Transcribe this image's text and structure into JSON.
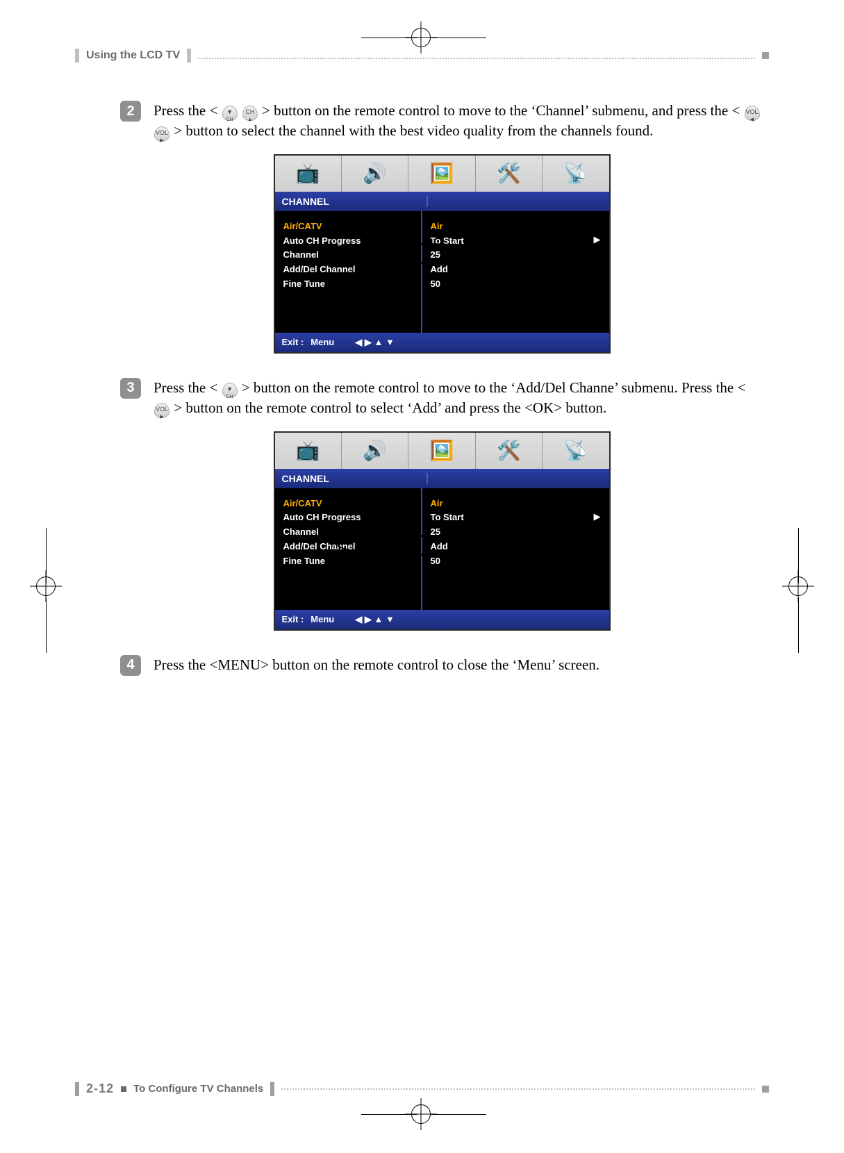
{
  "header": {
    "title": "Using the LCD TV"
  },
  "steps": [
    {
      "num": "2",
      "text_segments": [
        "Press the < ",
        "[CH-DN]",
        " ",
        "[CH-UP]",
        " > button on the remote control to move to the ‘Channel’ submenu, and press the < ",
        "[VOL-L]",
        " ",
        "[VOL-R]",
        " > button to select the channel with the best video quality from the channels found."
      ]
    },
    {
      "num": "3",
      "text_segments": [
        "Press the < ",
        "[CH-DN]",
        " > button on the remote control to move to the ‘Add/Del Channe’ submenu. Press the < ",
        "[VOL-R]",
        " > button on the remote control to select ‘Add’ and press the <OK> button."
      ]
    },
    {
      "num": "4",
      "text_segments": [
        "Press the <MENU> button on the remote control to close the ‘Menu’ screen."
      ]
    }
  ],
  "osd": {
    "title": "CHANNEL",
    "footer_exit": "Exit :",
    "footer_menu": "Menu",
    "footer_arrows": "◀ ▶ ▲ ▼",
    "rows": [
      {
        "label": "Air/CATV",
        "value": "Air",
        "highlight": true
      },
      {
        "label": "Auto CH Progress",
        "value": "To Start",
        "arrow": true
      },
      {
        "label": "Channel",
        "value": "25"
      },
      {
        "label": "Add/Del Channel",
        "value": "Add"
      },
      {
        "label": "Fine Tune",
        "value": "50"
      }
    ],
    "ellipse_targets": {
      "screen1_row_index": 2,
      "screen2_row_index": 3
    }
  },
  "footer": {
    "page_num": "2-12",
    "section": "To Configure TV Channels"
  },
  "remote_buttons": {
    "CH-DN": {
      "top": "▼",
      "bottom": "CH"
    },
    "CH-UP": {
      "top": "CH",
      "bottom": "▲"
    },
    "VOL-L": {
      "top": "VOL",
      "bottom": "◀"
    },
    "VOL-R": {
      "top": "VOL",
      "bottom": "▶"
    }
  }
}
